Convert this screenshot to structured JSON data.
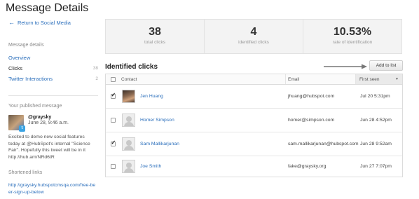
{
  "page": {
    "title": "Message Details"
  },
  "sidebar": {
    "back_label": "Return to Social Media",
    "details_label": "Message details",
    "nav": [
      {
        "label": "Overview",
        "count": ""
      },
      {
        "label": "Clicks",
        "count": "38"
      },
      {
        "label": "Twitter Interactions",
        "count": "2"
      }
    ],
    "published_label": "Your published message",
    "tweet": {
      "user": "@graysky",
      "date": "June 28, 9:46 a.m.",
      "text": "Excited to demo new social features today at @HubSpot's internal \"Science Fair\". Hopefully this tweet will be in it http://hub.am/NRd6tR"
    },
    "short_label": "Shortened links",
    "short_link": "http://graysky.hubspotcmsqa.com/free-beer-sign-up-below"
  },
  "stats": [
    {
      "value": "38",
      "label": "total clicks"
    },
    {
      "value": "4",
      "label": "identified clicks"
    },
    {
      "value": "10.53%",
      "label": "rate of identification"
    }
  ],
  "clicks": {
    "title": "Identified clicks",
    "add_button": "Add to list",
    "columns": {
      "contact": "Contact",
      "email": "Email",
      "first_seen": "First seen"
    },
    "rows": [
      {
        "name": "Jen Huang",
        "email": "jhuang@hubspot.com",
        "first_seen": "Jul 20 5:31pm",
        "checked": true,
        "photo": true
      },
      {
        "name": "Homer Simpson",
        "email": "homer@simpson.com",
        "first_seen": "Jun 28 4:52pm",
        "checked": false,
        "photo": false
      },
      {
        "name": "Sam Mallikarjunan",
        "email": "sam.mallikarjunan@hubspot.com",
        "first_seen": "Jun 28 9:52am",
        "checked": true,
        "photo": false
      },
      {
        "name": "Joe Smith",
        "email": "fake@graysky.org",
        "first_seen": "Jun 27 7:07pm",
        "checked": false,
        "photo": false
      }
    ]
  }
}
